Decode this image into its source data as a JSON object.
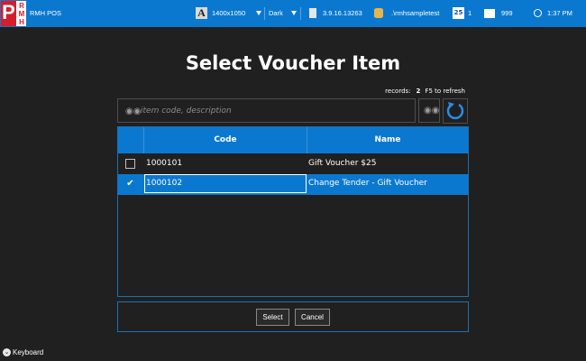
{
  "app": {
    "logo_letters": [
      "P",
      "R",
      "M",
      "H"
    ],
    "title": "RMH POS"
  },
  "topbar": {
    "resolution": "1400x1050",
    "theme": "Dark",
    "version": "3.9.16.13263",
    "database": ".\\rmhsampletest",
    "register": "1",
    "user": "999",
    "time": "1:37 PM"
  },
  "page": {
    "title": "Select Voucher Item",
    "records_label": "records:",
    "records_count": "2",
    "refresh_hint": "F5 to refresh"
  },
  "search": {
    "placeholder": "item code, description"
  },
  "grid": {
    "columns": [
      "Code",
      "Name"
    ],
    "rows": [
      {
        "code": "1000101",
        "name": "Gift Voucher $25",
        "checked": false
      },
      {
        "code": "1000102",
        "name": "Change Tender - Gift Voucher",
        "checked": true
      }
    ]
  },
  "actions": {
    "select_label": "Select",
    "cancel_label": "Cancel"
  },
  "keyboard": {
    "label": "Keyboard"
  },
  "colors": {
    "accent": "#0b78d0",
    "background": "#202020",
    "logo_red": "#d41e2c"
  }
}
